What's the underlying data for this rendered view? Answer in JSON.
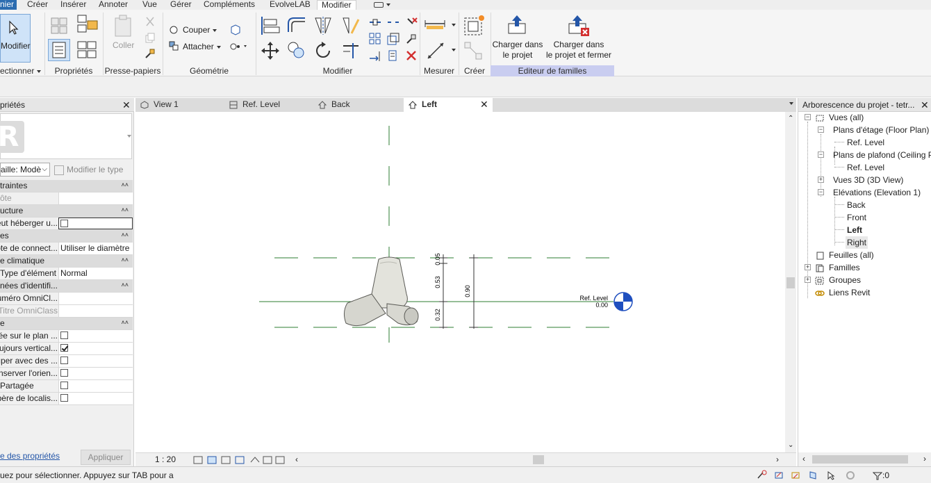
{
  "menu": {
    "items": [
      "nier",
      "Créer",
      "Insérer",
      "Annoter",
      "Vue",
      "Gérer",
      "Compléments",
      "EvolveLAB",
      "Modifier"
    ],
    "active": "Modifier"
  },
  "ribbon": {
    "select": {
      "label": "Modifier",
      "panel": "ectionner"
    },
    "properties": {
      "panel": "Propriétés"
    },
    "clipboard": {
      "paste": "Coller",
      "panel": "Presse-papiers"
    },
    "geometry": {
      "cut": "Couper",
      "join": "Attacher",
      "panel": "Géométrie"
    },
    "modify": {
      "panel": "Modifier"
    },
    "measure": {
      "panel": "Mesurer"
    },
    "create": {
      "panel": "Créer"
    },
    "family_editor": {
      "load_line1": "Charger dans",
      "load_line2": "le projet",
      "load_close_line1": "Charger dans",
      "load_close_line2": "le projet et fermer",
      "panel": "Editeur de familles"
    }
  },
  "properties_panel": {
    "title": "priétés",
    "family_selector": "aille: Modè",
    "edit_type": "Modifier le type",
    "rows": [
      {
        "type": "group",
        "label": "traintes"
      },
      {
        "type": "row",
        "label": "ôte",
        "value": "",
        "dim": true
      },
      {
        "type": "group",
        "label": "ucture"
      },
      {
        "type": "check",
        "label": "Peut héberger u...",
        "checked": false,
        "boxed": true
      },
      {
        "type": "group",
        "label": "es"
      },
      {
        "type": "row",
        "label": "Note de connect...",
        "value": "Utiliser le diamètre"
      },
      {
        "type": "group",
        "label": "e climatique"
      },
      {
        "type": "row",
        "label": "Type d'élément",
        "value": "Normal"
      },
      {
        "type": "group",
        "label": "nées d'identifi..."
      },
      {
        "type": "row",
        "label": "Numéro OmniCl...",
        "value": ""
      },
      {
        "type": "row",
        "label": "Titre OmniClass",
        "value": "",
        "dim": true
      },
      {
        "type": "group",
        "label": "e"
      },
      {
        "type": "check",
        "label": "Basée sur le plan ...",
        "checked": false
      },
      {
        "type": "check",
        "label": "Toujours vertical...",
        "checked": true
      },
      {
        "type": "check",
        "label": "Couper avec des ...",
        "checked": false
      },
      {
        "type": "check",
        "label": "Conserver l'orien...",
        "checked": false
      },
      {
        "type": "check",
        "label": "Partagée",
        "checked": false
      },
      {
        "type": "check",
        "label": "Repère de localis...",
        "checked": false
      }
    ],
    "link": "e des propriétés",
    "apply": "Appliquer"
  },
  "tabs": [
    {
      "label": "View 1",
      "active": false
    },
    {
      "label": "Ref. Level",
      "active": false
    },
    {
      "label": "Back",
      "active": false
    },
    {
      "label": "Left",
      "active": true
    }
  ],
  "canvas": {
    "level_name": "Ref. Level",
    "level_elev": "0.00",
    "dim_top": "0.05",
    "dim_mid": "0.53",
    "dim_bottom": "0.32",
    "dim_total": "0.90"
  },
  "view_control": {
    "scale": "1 : 20"
  },
  "browser": {
    "title": "Arborescence du projet - tetr...",
    "nodes": [
      {
        "label": "Vues (all)",
        "bold": false,
        "selected": false
      },
      {
        "label": "Plans d'étage (Floor Plan)",
        "bold": false,
        "selected": false
      },
      {
        "label": "Ref. Level",
        "bold": false,
        "selected": false
      },
      {
        "label": "Plans de plafond (Ceiling P",
        "bold": false,
        "selected": false
      },
      {
        "label": "Ref. Level",
        "bold": false,
        "selected": false
      },
      {
        "label": "Vues 3D (3D View)",
        "bold": false,
        "selected": false
      },
      {
        "label": "Elévations (Elevation 1)",
        "bold": false,
        "selected": false
      },
      {
        "label": "Back",
        "bold": false,
        "selected": false
      },
      {
        "label": "Front",
        "bold": false,
        "selected": false
      },
      {
        "label": "Left",
        "bold": true,
        "selected": false
      },
      {
        "label": "Right",
        "bold": false,
        "selected": true
      },
      {
        "label": "Feuilles (all)",
        "bold": false,
        "selected": false
      },
      {
        "label": "Familles",
        "bold": false,
        "selected": false
      },
      {
        "label": "Groupes",
        "bold": false,
        "selected": false
      },
      {
        "label": "Liens Revit",
        "bold": false,
        "selected": false
      }
    ]
  },
  "status": {
    "text": "uez pour sélectionner. Appuyez sur TAB pour a",
    "filter_count": ":0"
  },
  "colors": {
    "accent": "#2b6cb0",
    "highlight_panel": "#c9cdf0",
    "reference_line": "#2e7d32",
    "level_marker": "#1f4fbf"
  }
}
